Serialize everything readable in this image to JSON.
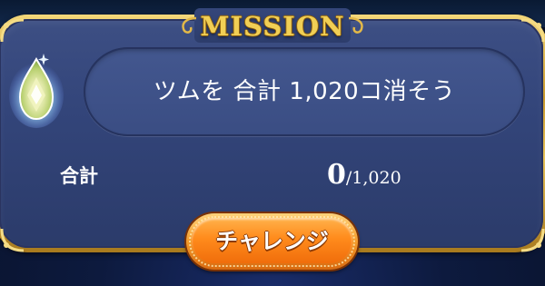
{
  "header": {
    "title": "MISSION"
  },
  "mission": {
    "description": "ツムを 合計 1,020コ消そう",
    "reward_icon": "gem-icon"
  },
  "progress": {
    "label": "合計",
    "current": "0",
    "separator": "/",
    "goal": "1,020"
  },
  "actions": {
    "challenge_label": "チャレンジ"
  },
  "colors": {
    "frame_gold": "#e6c25a",
    "panel_blue": "#33457a",
    "title_gold": "#f1cf55",
    "button_orange": "#ff8b1c",
    "text_white": "#ffffff"
  }
}
